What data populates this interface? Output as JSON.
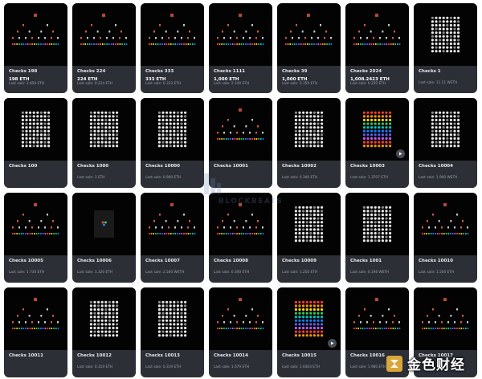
{
  "cards": [
    {
      "name": "Checks 198",
      "price": "198 ETH",
      "last": "Last sale: 2.850 ETH",
      "art": "pyramid"
    },
    {
      "name": "Checks 224",
      "price": "224 ETH",
      "last": "Last sale: 0.224 ETH",
      "art": "pyramid"
    },
    {
      "name": "Checks 333",
      "price": "333 ETH",
      "last": "Last sale: 0.333 ETH",
      "art": "pyramid"
    },
    {
      "name": "Checks 1111",
      "price": "1,000 ETH",
      "last": "Last sale: 2.140 ETH",
      "art": "pyramid"
    },
    {
      "name": "Checks 39",
      "price": "1,000 ETH",
      "last": "Last sale: 0.359 ETH",
      "art": "pyramid"
    },
    {
      "name": "Checks 2024",
      "price": "1,008.2423 ETH",
      "last": "Last sale: 0.230 ETH",
      "art": "pyramid"
    },
    {
      "name": "Checks 1",
      "price": "",
      "last": "Last sale: 11.11 WETH",
      "art": "whitegrid"
    },
    {
      "name": "Checks 100",
      "price": "",
      "last": "",
      "art": "whitegrid"
    },
    {
      "name": "Checks 1000",
      "price": "",
      "last": "Last sale: 1 ETH",
      "art": "whitegrid"
    },
    {
      "name": "Checks 10000",
      "price": "",
      "last": "Last sale: 0.900 ETH",
      "art": "whitegrid"
    },
    {
      "name": "Checks 10001",
      "price": "",
      "last": "",
      "art": "pyramid"
    },
    {
      "name": "Checks 10002",
      "price": "",
      "last": "Last sale: 0.340 ETH",
      "art": "whitegrid"
    },
    {
      "name": "Checks 10003",
      "price": "",
      "last": "Last sale: 1.3707 ETH",
      "art": "colorgrid",
      "play": true
    },
    {
      "name": "Checks 10004",
      "price": "",
      "last": "Last sale: 1.900 WETH",
      "art": "whitegrid"
    },
    {
      "name": "Checks 10005",
      "price": "",
      "last": "Last sale: 1.730 ETH",
      "art": "pyramid"
    },
    {
      "name": "Checks 10006",
      "price": "",
      "last": "Last sale: 1.320 ETH",
      "art": "single"
    },
    {
      "name": "Checks 10007",
      "price": "",
      "last": "Last sale: 2.500 WETH",
      "art": "pyramid"
    },
    {
      "name": "Checks 10008",
      "price": "",
      "last": "Last sale: 0.300 ETH",
      "art": "pyramid"
    },
    {
      "name": "Checks 10009",
      "price": "",
      "last": "Last sale: 1.250 ETH",
      "art": "whitegrid"
    },
    {
      "name": "Checks 1001",
      "price": "",
      "last": "Last sale: 0.198 WETH",
      "art": "whitegrid"
    },
    {
      "name": "Checks 10010",
      "price": "",
      "last": "Last sale: 1.500 ETH",
      "art": "pyramid"
    },
    {
      "name": "Checks 10011",
      "price": "",
      "last": "",
      "art": "pyramid"
    },
    {
      "name": "Checks 10012",
      "price": "",
      "last": "Last sale: 0.319 ETH",
      "art": "whitegrid"
    },
    {
      "name": "Checks 10013",
      "price": "",
      "last": "Last sale: 0.319 ETH",
      "art": "whitegrid"
    },
    {
      "name": "Checks 10014",
      "price": "",
      "last": "Last sale: 1.679 ETH",
      "art": "pyramid"
    },
    {
      "name": "Checks 10015",
      "price": "",
      "last": "Last sale: 1.6463 ETH",
      "art": "colorgrid",
      "play": true
    },
    {
      "name": "Checks 10016",
      "price": "",
      "last": "Last sale: 1.980 ETH",
      "art": "pyramid"
    },
    {
      "name": "Checks 10017",
      "price": "",
      "last": "",
      "art": "pyramid"
    }
  ],
  "icons": {
    "play": "play-icon"
  },
  "colors": {
    "card": "#2c2f36",
    "artwork_bg": "#030303",
    "rainbow": [
      "#ff3b30",
      "#ff9500",
      "#ffd60a",
      "#34c759",
      "#00c7be",
      "#0a84ff",
      "#5e5ce6",
      "#bf5af2"
    ]
  },
  "watermark": {
    "text": "BLOCKBEATS"
  },
  "brand": {
    "text": "金色财经"
  }
}
